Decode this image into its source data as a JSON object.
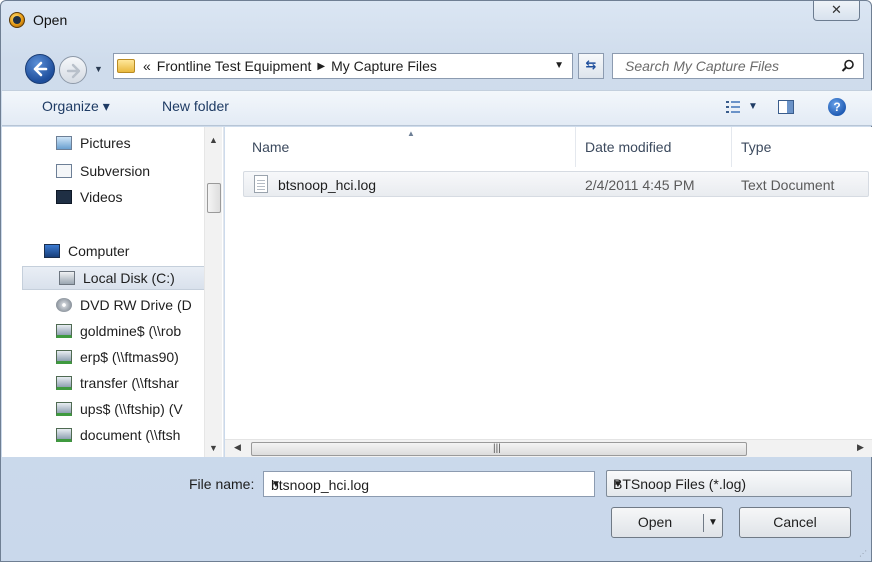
{
  "window": {
    "title": "Open",
    "close_glyph": "✕"
  },
  "nav": {
    "breadcrumb_prefix": "«",
    "breadcrumbs": [
      "Frontline Test Equipment",
      "My Capture Files"
    ],
    "search_placeholder": "Search My Capture Files"
  },
  "toolbar": {
    "organize_label": "Organize ▾",
    "new_folder_label": "New folder",
    "help_glyph": "?"
  },
  "sidebar": {
    "items": [
      {
        "label": "Pictures",
        "icon": "pictures-icon"
      },
      {
        "label": "Subversion",
        "icon": "subversion-icon"
      },
      {
        "label": "Videos",
        "icon": "videos-icon"
      },
      {
        "label": "Computer",
        "icon": "computer-icon"
      },
      {
        "label": "Local Disk (C:)",
        "icon": "local-disk-icon"
      },
      {
        "label": "DVD RW Drive (D",
        "icon": "dvd-drive-icon"
      },
      {
        "label": "goldmine$ (\\\\rob",
        "icon": "network-drive-icon"
      },
      {
        "label": "erp$ (\\\\ftmas90)",
        "icon": "network-drive-icon"
      },
      {
        "label": "transfer (\\\\ftshar",
        "icon": "network-drive-icon"
      },
      {
        "label": "ups$ (\\\\ftship) (V",
        "icon": "network-drive-icon"
      },
      {
        "label": "document (\\\\ftsh",
        "icon": "network-drive-icon"
      }
    ]
  },
  "filelist": {
    "columns": [
      "Name",
      "Date modified",
      "Type"
    ],
    "rows": [
      {
        "name": "btsnoop_hci.log",
        "date_modified": "2/4/2011 4:45 PM",
        "type": "Text Document"
      }
    ]
  },
  "bottom": {
    "filename_label": "File name:",
    "filename_value": "btsnoop_hci.log",
    "filetype_value": "BTSnoop Files (*.log)",
    "open_label": "Open",
    "cancel_label": "Cancel"
  },
  "colors": {
    "window_frame": "#cfdcec",
    "selection": "#d9e1ec",
    "accent_blue": "#1e4e9c"
  }
}
